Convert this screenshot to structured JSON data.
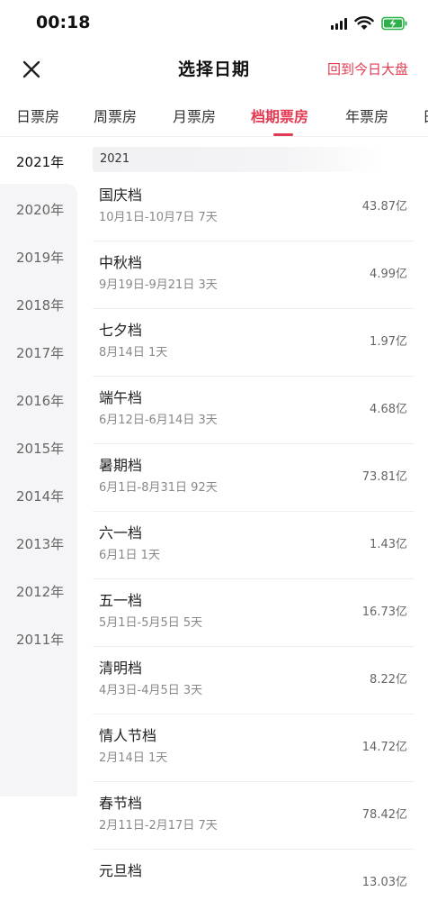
{
  "status_bar": {
    "time": "00:18"
  },
  "header": {
    "title": "选择日期",
    "back_today": "回到今日大盘"
  },
  "tabs": [
    {
      "label": "日票房"
    },
    {
      "label": "周票房"
    },
    {
      "label": "月票房"
    },
    {
      "label": "档期票房",
      "active": true
    },
    {
      "label": "年票房"
    },
    {
      "label": "日"
    }
  ],
  "years": [
    {
      "label": "2021年",
      "active": true
    },
    {
      "label": "2020年"
    },
    {
      "label": "2019年"
    },
    {
      "label": "2018年"
    },
    {
      "label": "2017年"
    },
    {
      "label": "2016年"
    },
    {
      "label": "2015年"
    },
    {
      "label": "2014年"
    },
    {
      "label": "2013年"
    },
    {
      "label": "2012年"
    },
    {
      "label": "2011年"
    }
  ],
  "section": {
    "year_label": "2021"
  },
  "periods": [
    {
      "name": "国庆档",
      "range": "10月1日-10月7日 7天",
      "box_office": "43.87亿"
    },
    {
      "name": "中秋档",
      "range": "9月19日-9月21日 3天",
      "box_office": "4.99亿"
    },
    {
      "name": "七夕档",
      "range": "8月14日 1天",
      "box_office": "1.97亿"
    },
    {
      "name": "端午档",
      "range": "6月12日-6月14日 3天",
      "box_office": "4.68亿"
    },
    {
      "name": "暑期档",
      "range": "6月1日-8月31日 92天",
      "box_office": "73.81亿"
    },
    {
      "name": "六一档",
      "range": "6月1日 1天",
      "box_office": "1.43亿"
    },
    {
      "name": "五一档",
      "range": "5月1日-5月5日 5天",
      "box_office": "16.73亿"
    },
    {
      "name": "清明档",
      "range": "4月3日-4月5日 3天",
      "box_office": "8.22亿"
    },
    {
      "name": "情人节档",
      "range": "2月14日 1天",
      "box_office": "14.72亿"
    },
    {
      "name": "春节档",
      "range": "2月11日-2月17日 7天",
      "box_office": "78.42亿"
    },
    {
      "name": "元旦档",
      "range": "",
      "box_office": "13.03亿"
    }
  ],
  "colors": {
    "accent": "#e23a52",
    "sidebar_bg": "#f5f5f7",
    "divider": "#eeeeee"
  }
}
